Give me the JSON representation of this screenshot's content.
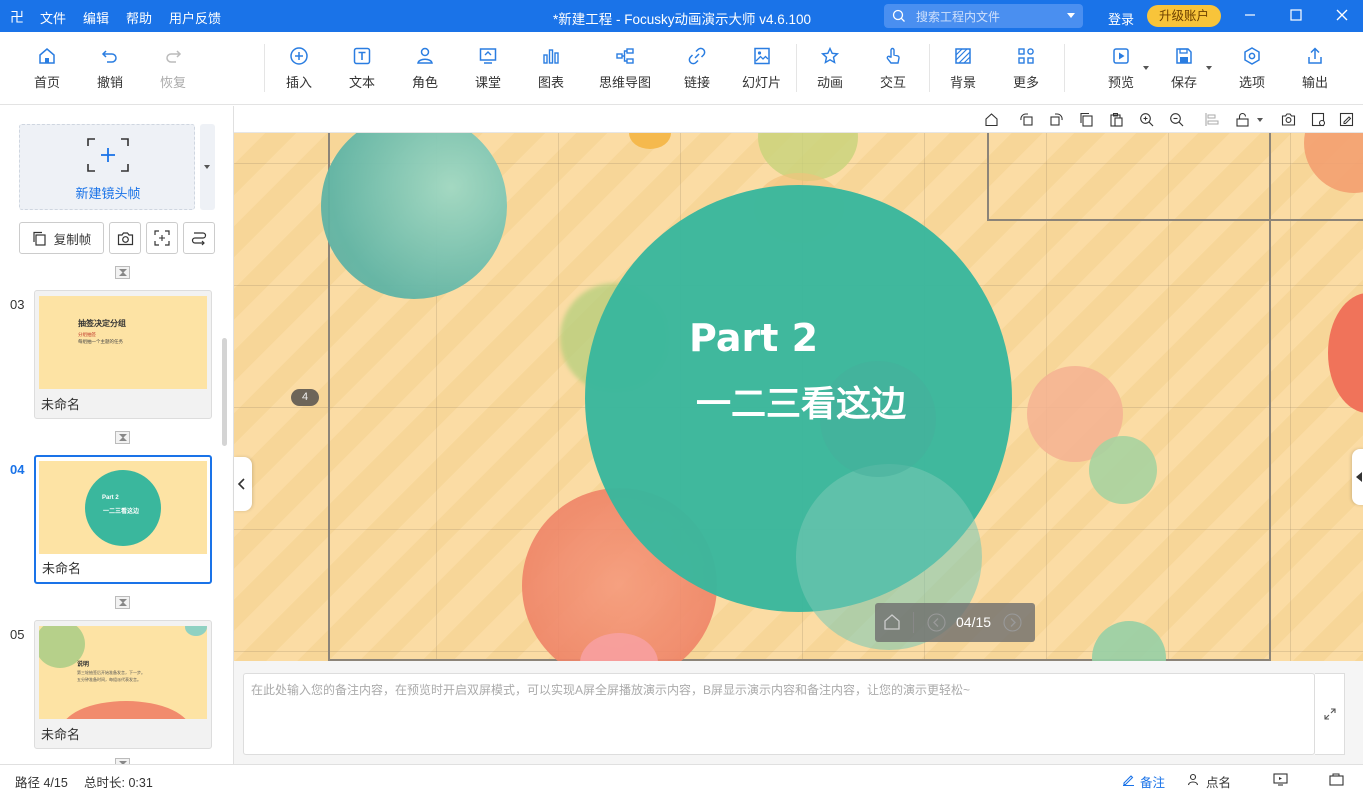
{
  "titlebar": {
    "menu": [
      "文件",
      "编辑",
      "帮助",
      "用户反馈"
    ],
    "title": "*新建工程 - Focusky动画演示大师  v4.6.100",
    "search_placeholder": "搜索工程内文件",
    "login": "登录",
    "upgrade": "升级账户"
  },
  "toolbar": {
    "home": "首页",
    "undo": "撤销",
    "redo": "恢复",
    "insert": "插入",
    "text": "文本",
    "role": "角色",
    "class": "课堂",
    "chart": "图表",
    "mindmap": "思维导图",
    "link": "链接",
    "slideshow": "幻灯片",
    "animation": "动画",
    "interact": "交互",
    "background": "背景",
    "more": "更多",
    "preview": "预览",
    "save": "保存",
    "options": "选项",
    "export": "输出"
  },
  "leftpanel": {
    "new_frame": "新建镜头帧",
    "copy_frame": "复制帧",
    "slides": [
      {
        "num": "03",
        "name": "未命名",
        "title": "抽签决定分组",
        "line1": "分组抽签",
        "line2": "每组抽一个主题的任务"
      },
      {
        "num": "04",
        "name": "未命名",
        "title": "Part 2",
        "line1": "一二三看这边"
      },
      {
        "num": "05",
        "name": "未命名",
        "title": "说明",
        "line1": "第三轮抽签后开始准备发言，下一步。",
        "line2": "五分钟准备时间，每组派代表发言。"
      }
    ]
  },
  "canvas": {
    "part_title": "Part 2",
    "part_subtitle": "一二三看这边",
    "frame_badge": "4",
    "page_indicator": "04/15"
  },
  "notes": {
    "placeholder": "在此处输入您的备注内容，在预览时开启双屏模式，可以实现A屏全屏播放演示内容，B屏显示演示内容和备注内容，让您的演示更轻松~"
  },
  "statusbar": {
    "path": "路径 4/15",
    "duration": "总时长: 0:31",
    "notes": "备注",
    "rollcall": "点名"
  }
}
